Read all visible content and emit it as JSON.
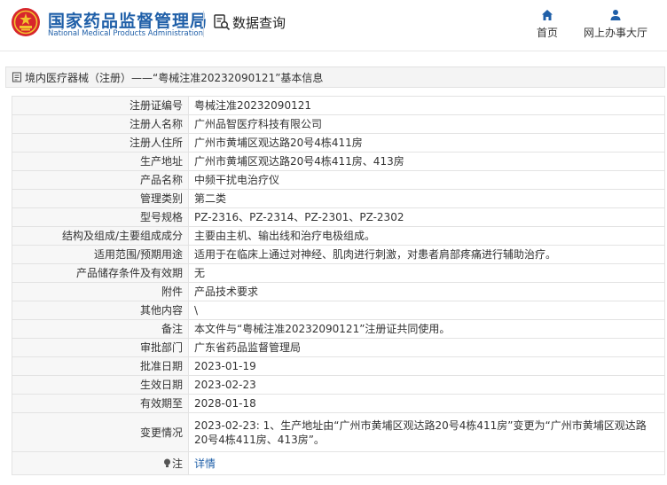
{
  "header": {
    "site_name_cn": "国家药品监督管理局",
    "site_name_en": "National Medical Products Administration",
    "page_title": "数据查询",
    "nav": [
      {
        "label": "首页",
        "icon": "home-icon"
      },
      {
        "label": "网上办事大厅",
        "icon": "user-icon"
      }
    ]
  },
  "breadcrumb": {
    "text": "境内医疗器械（注册）——“粤械注准20232090121”基本信息"
  },
  "record": {
    "rows": [
      {
        "label": "注册证编号",
        "value": "粤械注准20232090121"
      },
      {
        "label": "注册人名称",
        "value": "广州品智医疗科技有限公司"
      },
      {
        "label": "注册人住所",
        "value": "广州市黄埔区观达路20号4栋411房"
      },
      {
        "label": "生产地址",
        "value": "广州市黄埔区观达路20号4栋411房、413房"
      },
      {
        "label": "产品名称",
        "value": "中频干扰电治疗仪"
      },
      {
        "label": "管理类别",
        "value": "第二类"
      },
      {
        "label": "型号规格",
        "value": "PZ-2316、PZ-2314、PZ-2301、PZ-2302"
      },
      {
        "label": "结构及组成/主要组成成分",
        "value": "主要由主机、输出线和治疗电极组成。"
      },
      {
        "label": "适用范围/预期用途",
        "value": "适用于在临床上通过对神经、肌肉进行刺激，对患者肩部疼痛进行辅助治疗。"
      },
      {
        "label": "产品储存条件及有效期",
        "value": "无"
      },
      {
        "label": "附件",
        "value": "产品技术要求"
      },
      {
        "label": "其他内容",
        "value": "\\"
      },
      {
        "label": "备注",
        "value": "本文件与“粤械注准20232090121”注册证共同使用。"
      },
      {
        "label": "审批部门",
        "value": "广东省药品监督管理局"
      },
      {
        "label": "批准日期",
        "value": "2023-01-19"
      },
      {
        "label": "生效日期",
        "value": "2023-02-23"
      },
      {
        "label": "有效期至",
        "value": "2028-01-18"
      }
    ],
    "change": {
      "label": "变更情况",
      "value": "2023-02-23: 1、生产地址由“广州市黄埔区观达路20号4栋411房”变更为“广州市黄埔区观达路20号4栋411房、413房”。"
    },
    "note": {
      "label": "注",
      "link": "详情"
    }
  },
  "colors": {
    "brand_blue": "#1f5fa8",
    "emblem_red": "#d7262c",
    "emblem_gold": "#f2c12e"
  }
}
